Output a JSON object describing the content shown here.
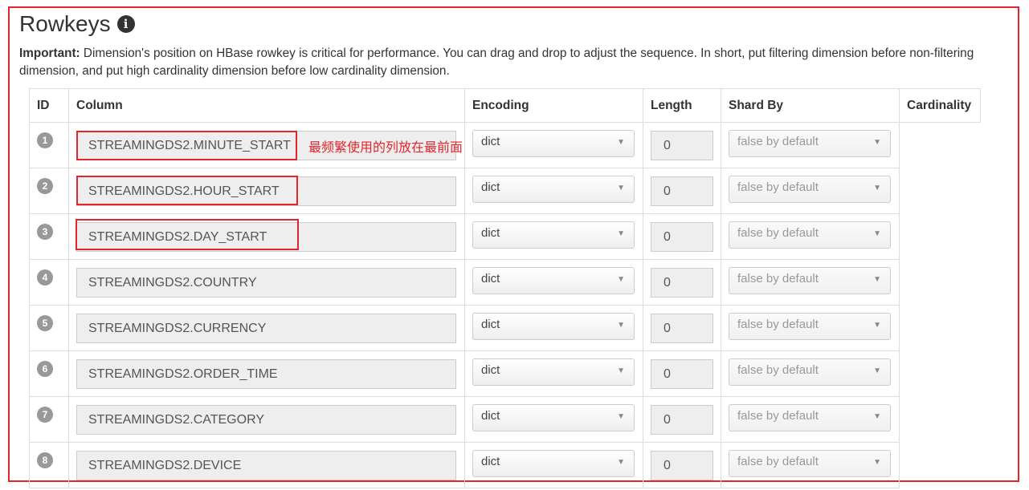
{
  "section": {
    "title": "Rowkeys",
    "info_icon": "info-circle-icon",
    "note_label": "Important:",
    "note_text": " Dimension's position on HBase rowkey is critical for performance. You can drag and drop to adjust the sequence. In short, put filtering dimension before non-filtering dimension, and put high cardinality dimension before low cardinality dimension."
  },
  "table": {
    "headers": {
      "id": "ID",
      "column": "Column",
      "encoding": "Encoding",
      "length": "Length",
      "shard_by": "Shard By",
      "cardinality": "Cardinality"
    },
    "rows": [
      {
        "id": "1",
        "column": "STREAMINGDS2.MINUTE_START",
        "encoding": "dict",
        "length": "0",
        "shard_by": "false by default"
      },
      {
        "id": "2",
        "column": "STREAMINGDS2.HOUR_START",
        "encoding": "dict",
        "length": "0",
        "shard_by": "false by default"
      },
      {
        "id": "3",
        "column": "STREAMINGDS2.DAY_START",
        "encoding": "dict",
        "length": "0",
        "shard_by": "false by default"
      },
      {
        "id": "4",
        "column": "STREAMINGDS2.COUNTRY",
        "encoding": "dict",
        "length": "0",
        "shard_by": "false by default"
      },
      {
        "id": "5",
        "column": "STREAMINGDS2.CURRENCY",
        "encoding": "dict",
        "length": "0",
        "shard_by": "false by default"
      },
      {
        "id": "6",
        "column": "STREAMINGDS2.ORDER_TIME",
        "encoding": "dict",
        "length": "0",
        "shard_by": "false by default"
      },
      {
        "id": "7",
        "column": "STREAMINGDS2.CATEGORY",
        "encoding": "dict",
        "length": "0",
        "shard_by": "false by default"
      },
      {
        "id": "8",
        "column": "STREAMINGDS2.DEVICE",
        "encoding": "dict",
        "length": "0",
        "shard_by": "false by default"
      }
    ]
  },
  "annotation": {
    "text": "最频繁使用的列放在最前面",
    "color": "#e3262b"
  }
}
